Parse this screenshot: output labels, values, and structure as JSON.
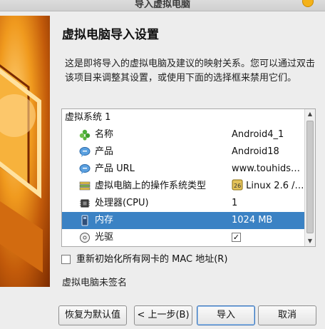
{
  "window": {
    "title": "导入虚拟电脑"
  },
  "page": {
    "heading": "虚拟电脑导入设置",
    "description": "这是即将导入的虚拟电脑及建议的映射关系。您可以通过双击该项目来调整其设置，或使用下面的选择框来禁用它们。"
  },
  "tree": {
    "group_label": "虚拟系统 1",
    "rows": [
      {
        "label": "名称",
        "value": "Android4_1",
        "icon": "name-icon"
      },
      {
        "label": "产品",
        "value": "Android18",
        "icon": "product-icon"
      },
      {
        "label": "产品 URL",
        "value": "www.touhids…",
        "icon": "product-url-icon"
      },
      {
        "label": "虚拟电脑上的操作系统类型",
        "value": "Linux 2.6 /…",
        "icon": "os-type-icon"
      },
      {
        "label": "处理器(CPU)",
        "value": "1",
        "icon": "cpu-icon"
      },
      {
        "label": "内存",
        "value": "1024 MB",
        "icon": "memory-icon"
      },
      {
        "label": "光驱",
        "value": "✓",
        "icon": "optical-drive-icon"
      }
    ]
  },
  "options": {
    "reinit_mac_label": "重新初始化所有网卡的 MAC 地址(R)"
  },
  "status": {
    "unsigned": "虚拟电脑未签名"
  },
  "buttons": {
    "restore": "恢复为默认值",
    "back": "< 上一步(B)",
    "import": "导入",
    "cancel": "取消"
  },
  "colors": {
    "selection": "#3b82c4",
    "accent": "#f4b21a"
  }
}
